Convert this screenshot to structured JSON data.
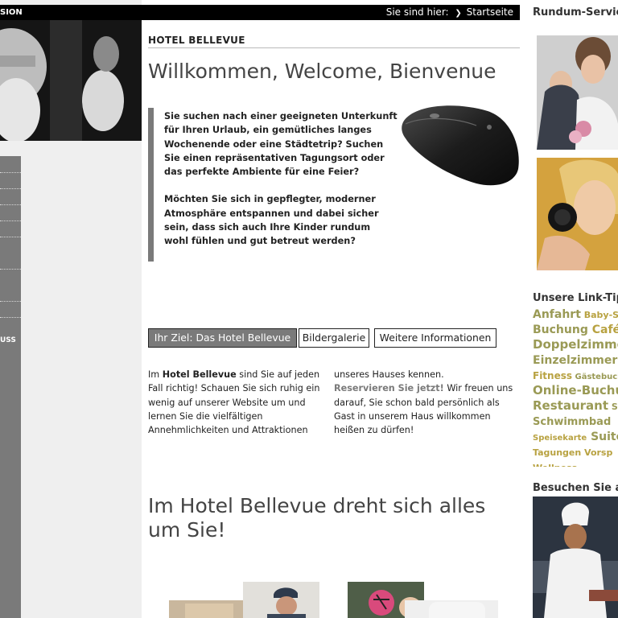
{
  "left": {
    "top_bar_label": "SION",
    "nav_label": "USS"
  },
  "header": {
    "breadcrumb_label": "Sie sind hier:",
    "breadcrumb_link": "Startseite"
  },
  "main": {
    "hotel_name": "HOTEL BELLEVUE",
    "welcome_title": "Willkommen, Welcome, Bienvenue",
    "intro_paragraphs": [
      "Sie suchen nach einer geeigneten Unterkunft für Ihren Urlaub, ein gemütliches langes Wochenende oder eine Städtetrip? Suchen Sie einen repräsentativen Tagungsort oder das perfekte Ambiente für eine Feier?",
      "Möchten Sie sich in gepflegter, moderner Atmosphäre entspannen und dabei sicher sein, dass sich auch Ihre Kinder rundum wohl fühlen und gut betreut werden?"
    ],
    "tabs": [
      {
        "label": "Ihr Ziel: Das Hotel Bellevue",
        "active": true
      },
      {
        "label": "Bildergalerie",
        "active": false
      },
      {
        "label": "Weitere Informationen",
        "active": false
      }
    ],
    "body_col1": {
      "pre": "Im ",
      "bold": "Hotel Bellevue",
      "post": " sind Sie auf jeden Fall richtig! Schauen Sie sich ruhig ein wenig auf unserer Website um und lernen Sie die vielfältigen Annehmlichkeiten und Attraktionen"
    },
    "body_col2": {
      "pre": "unseres Hauses kennen.",
      "link": "Reservieren Sie jetzt!",
      "post": " Wir freuen uns darauf, Sie schon bald persönlich als Gast in unserem Haus willkommen heißen zu dürfen!"
    },
    "subheading": "Im Hotel Bellevue dreht sich alles um Sie!"
  },
  "right": {
    "service_title": "Rundum-Servic Sie!",
    "link_title": "Unsere Link-Tip",
    "visit_title": "Besuchen Sie a",
    "tags": [
      [
        {
          "text": "Anfahrt",
          "size": 14,
          "alt": false
        },
        {
          "text": " Baby-S",
          "size": 11,
          "alt": true
        }
      ],
      [
        {
          "text": "Buchung",
          "size": 14,
          "alt": false
        },
        {
          "text": " Café",
          "size": 14,
          "alt": true
        }
      ],
      [
        {
          "text": "Doppelzimme",
          "size": 15,
          "alt": false
        }
      ],
      [
        {
          "text": "Einzelzimmer",
          "size": 14,
          "alt": false
        }
      ],
      [
        {
          "text": "Fitness",
          "size": 12,
          "alt": true
        },
        {
          "text": " Gästebuch",
          "size": 10,
          "alt": false
        }
      ],
      [
        {
          "text": "Online-Buchu",
          "size": 15,
          "alt": false
        }
      ],
      [
        {
          "text": "Restaurant",
          "size": 15,
          "alt": false
        },
        {
          "text": " S",
          "size": 11,
          "alt": false
        }
      ],
      [
        {
          "text": "Schwimmbad",
          "size": 13,
          "alt": false
        }
      ],
      [
        {
          "text": "Speisekarte",
          "size": 10,
          "alt": true
        },
        {
          "text": " Suite",
          "size": 14,
          "alt": false
        }
      ],
      [
        {
          "text": "Tagungen Vorsp",
          "size": 11,
          "alt": true
        }
      ],
      [
        {
          "text": "Wellness",
          "size": 11,
          "alt": true
        }
      ]
    ]
  }
}
